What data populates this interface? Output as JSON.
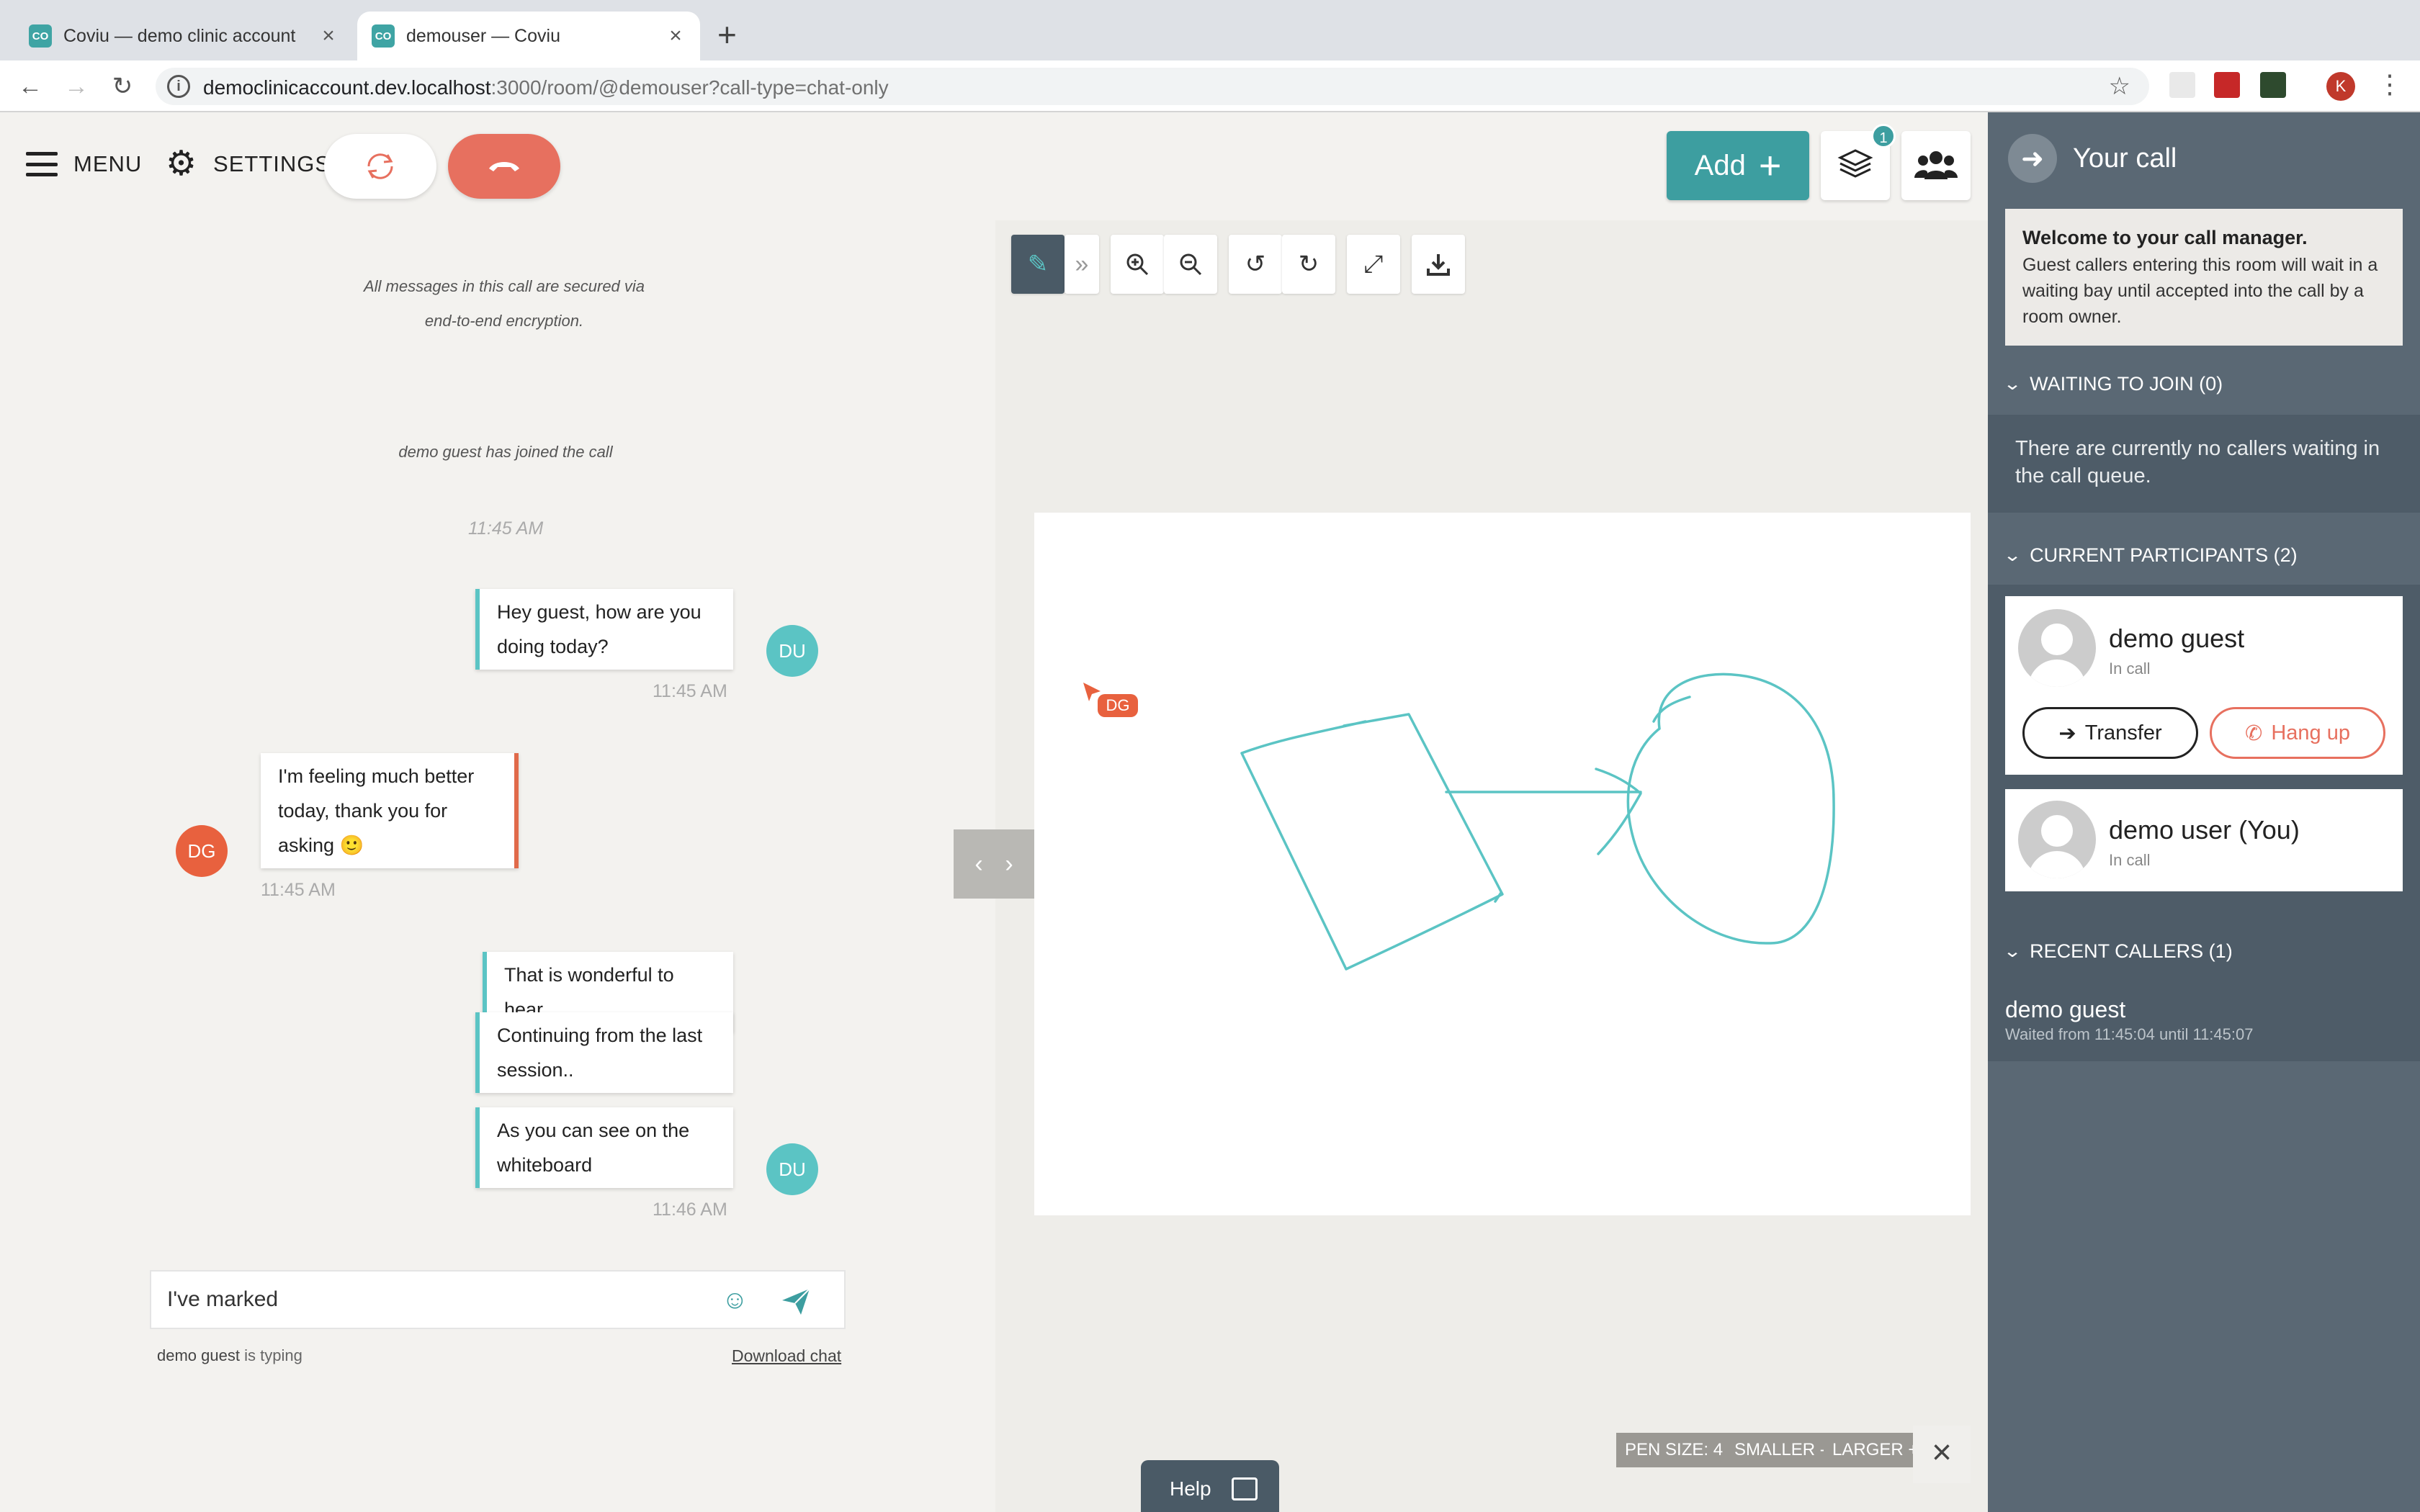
{
  "browser": {
    "tabs": [
      {
        "title": "Coviu — demo clinic account",
        "favicon": "CO"
      },
      {
        "title": "demouser — Coviu",
        "favicon": "CO"
      }
    ],
    "url_host": "democlinicaccount.dev.localhost",
    "url_rest": ":3000/room/@demouser?call-type=chat-only",
    "profile_initial": "K"
  },
  "topbar": {
    "menu_label": "MENU",
    "settings_label": "SETTINGS",
    "add_label": "Add",
    "layers_badge": "1"
  },
  "chat": {
    "system_messages": [
      {
        "text": "All messages in this call are secured via end-to-end encryption."
      },
      {
        "text": "demo guest has joined the call",
        "time": "11:45 AM"
      }
    ],
    "messages": [
      {
        "text": "Hey guest, how are you doing today?",
        "sender": "DU",
        "time": "11:45 AM"
      },
      {
        "text": "I'm feeling much better today, thank you for asking 🙂",
        "sender": "DG",
        "time": "11:45 AM"
      },
      {
        "text": "That is wonderful to hear",
        "sender": "DU"
      },
      {
        "text": "Continuing from the last session..",
        "sender": "DU"
      },
      {
        "text": "As you can see on the whiteboard",
        "sender": "DU",
        "time": "11:46 AM"
      }
    ],
    "input_value": "I've marked",
    "typing_user": "demo guest",
    "typing_suffix": "is typing",
    "download_label": "Download chat"
  },
  "whiteboard": {
    "cursor_label": "DG",
    "pen_size_label": "PEN SIZE: 4",
    "smaller_label": "SMALLER -",
    "larger_label": "LARGER +",
    "stroke_color": "#5bc4c4"
  },
  "help": {
    "label": "Help"
  },
  "panel": {
    "title": "Your call",
    "welcome_title": "Welcome to your call manager.",
    "welcome_text": "Guest callers entering this room will wait in a waiting bay until accepted into the call by a room owner.",
    "waiting_header": "WAITING TO JOIN (0)",
    "waiting_empty": "There are currently no callers waiting in the call queue.",
    "participants_header": "CURRENT PARTICIPANTS (2)",
    "participants": [
      {
        "name": "demo guest",
        "status": "In call"
      },
      {
        "name": "demo user (You)",
        "status": "In call"
      }
    ],
    "transfer_label": "Transfer",
    "hangup_label": "Hang up",
    "recent_header": "RECENT CALLERS (1)",
    "recent": [
      {
        "name": "demo guest",
        "detail": "Waited from 11:45:04 until 11:45:07"
      }
    ]
  },
  "colors": {
    "accent": "#3d9ea0",
    "hangup": "#e7705f",
    "panel": "#5a6874"
  }
}
